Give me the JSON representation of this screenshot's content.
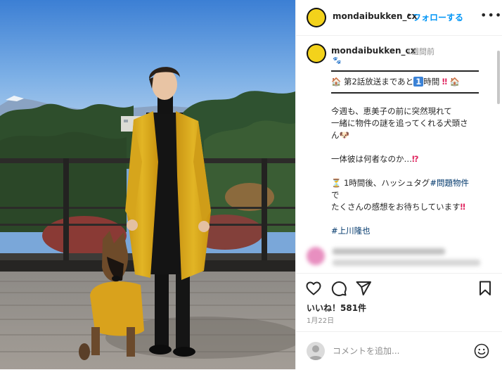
{
  "header": {
    "username": "mondaibukken_cx",
    "separator": "•",
    "follow_label": "フォローする",
    "more_label": "•••"
  },
  "caption": {
    "username": "mondaibukken_cx",
    "time": "1週間前",
    "paw_icons": "🐾",
    "lines": {
      "countdown_a": "第2話放送まであと",
      "countdown_num": "1",
      "countdown_b": "時間",
      "bang": "‼",
      "l1": "今週も、恵美子の前に突然現れて",
      "l2": "一緒に物件の謎を追ってくれる犬頭さ",
      "l3": "ん",
      "dog_emoji": "🐶",
      "l4": "一体彼は何者なのか…",
      "q_bang": "⁉",
      "hourglass": "⏳",
      "l5": "1時間後、ハッシュタグ",
      "hashtag1": "#問題物件",
      "l6": "で",
      "l7": "たくさんの感想をお待ちしています",
      "hashtag2": "#上川隆也",
      "house_emoji": "🏠"
    }
  },
  "actions": {
    "like_icon": "heart-outline",
    "comment_icon": "speech-bubble",
    "share_icon": "paper-plane",
    "save_icon": "bookmark"
  },
  "likes_text": "いいね！581件",
  "date_text": "1月22日",
  "comment_bar": {
    "placeholder": "コメントを追加...",
    "emoji_icon": "smiley"
  },
  "colors": {
    "follow_blue": "#0095f6",
    "hashtag": "#00376b",
    "avatar_yellow": "#f3d21b",
    "coat_yellow": "#e0b021"
  }
}
